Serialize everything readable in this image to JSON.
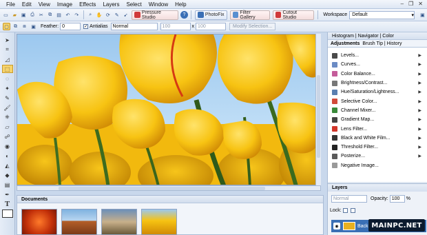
{
  "menu": [
    "File",
    "Edit",
    "View",
    "Image",
    "Effects",
    "Layers",
    "Select",
    "Window",
    "Help"
  ],
  "toolbar": {
    "pressure_studio": "Pressure Studio",
    "photofix": "PhotoFix",
    "filter_gallery": "Filter Gallery",
    "cutout_studio": "Cutout Studio",
    "workspace_label": "Workspace",
    "workspace_value": "Default"
  },
  "options": {
    "feather_label": "Feather:",
    "feather_value": "0",
    "antialias_label": "Antialias",
    "mode_value": "Normal",
    "width_value": "100",
    "x_label": "x",
    "height_value": "100",
    "modify_selection": "Modify Selection..."
  },
  "right_panel": {
    "tabs_top": "Histogram | Navigator | Color",
    "tab_active": "Adjustments",
    "tabs_rest": "Brush Tip | History",
    "adjustments": [
      {
        "label": "Levels...",
        "color": "#4a4a4a"
      },
      {
        "label": "Curves...",
        "color": "#6b8bc4"
      },
      {
        "label": "Color Balance...",
        "color": "#c45c9a"
      },
      {
        "label": "Brightness/Contrast...",
        "color": "#777777"
      },
      {
        "label": "Hue/Saturation/Lightness...",
        "color": "#5a7fb0"
      },
      {
        "label": "Selective Color...",
        "color": "#d24a3a"
      },
      {
        "label": "Channel Mixer...",
        "color": "#3a8a3a"
      },
      {
        "label": "Gradient Map...",
        "color": "#444444"
      },
      {
        "label": "Lens Filter...",
        "color": "#d0352a"
      },
      {
        "label": "Black and White Film...",
        "color": "#333333"
      },
      {
        "label": "Threshold Filter...",
        "color": "#222222"
      },
      {
        "label": "Posterize...",
        "color": "#5a5a5a"
      },
      {
        "label": "Negative Image...",
        "color": "#999999"
      }
    ],
    "layers": {
      "title": "Layers",
      "blend_mode": "Normal",
      "opacity_label": "Opacity:",
      "opacity_value": "100",
      "opacity_unit": "%",
      "lock_label": "Lock:",
      "layer_name": "Back"
    }
  },
  "documents": {
    "title": "Documents"
  },
  "watermark": "MAINPC.NET"
}
